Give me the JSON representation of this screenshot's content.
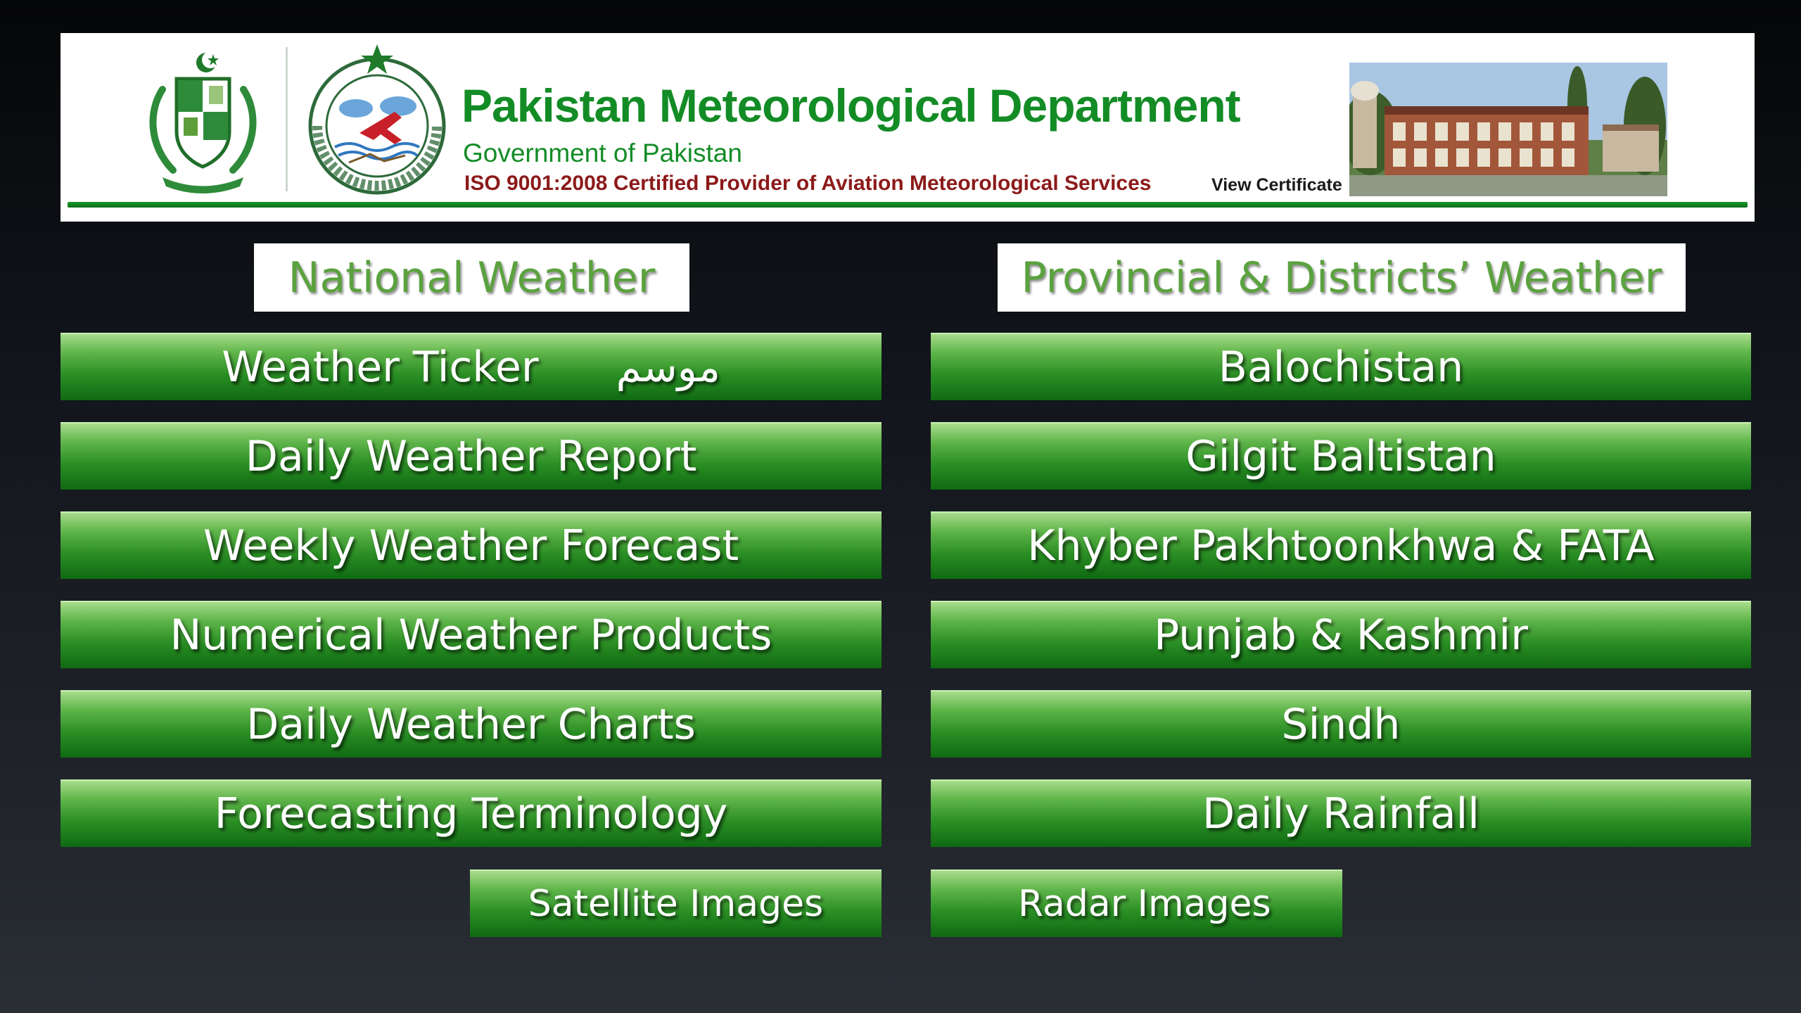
{
  "header": {
    "title": "Pakistan Meteorological Department",
    "subtitle": "Government of Pakistan",
    "certification": "ISO 9001:2008 Certified Provider of Aviation Meteorological Services",
    "view_certificate": "View Certificate",
    "accent_color": "#138c26",
    "certification_color": "#8c1a1a"
  },
  "sections": {
    "national": {
      "title": "National Weather",
      "items": [
        {
          "label": "Weather Ticker",
          "urdu": "موسم"
        },
        {
          "label": "Daily Weather Report"
        },
        {
          "label": "Weekly Weather Forecast"
        },
        {
          "label": "Numerical Weather Products"
        },
        {
          "label": "Daily Weather Charts"
        },
        {
          "label": "Forecasting Terminology"
        }
      ],
      "extra": {
        "label": "Satellite Images"
      }
    },
    "provincial": {
      "title": "Provincial & Districts’ Weather",
      "items": [
        {
          "label": "Balochistan"
        },
        {
          "label": "Gilgit Baltistan"
        },
        {
          "label": "Khyber Pakhtoonkhwa & FATA"
        },
        {
          "label": "Punjab & Kashmir"
        },
        {
          "label": "Sindh"
        },
        {
          "label": "Daily Rainfall"
        }
      ],
      "extra": {
        "label": "Radar Images"
      }
    }
  },
  "icons": {
    "emblem": "pakistan-state-emblem-icon",
    "pmd_logo": "pmd-logo-icon",
    "building": "headquarters-building-photo"
  },
  "button_color": "#2a8e24"
}
